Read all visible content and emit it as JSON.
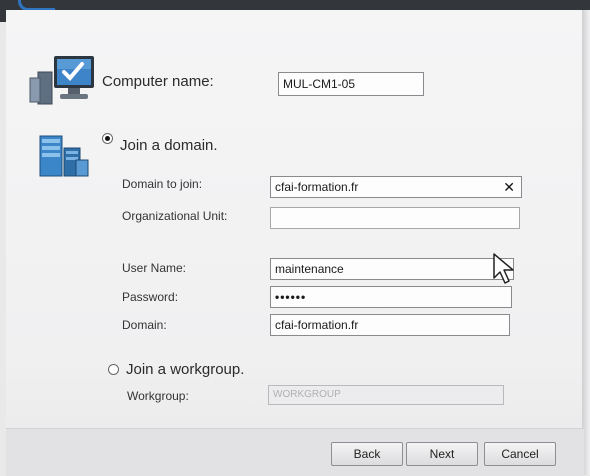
{
  "computer": {
    "label": "Computer name:",
    "value": "MUL-CM1-05"
  },
  "join_domain": {
    "label": "Join a domain.",
    "selected": true,
    "domain_to_join_label": "Domain to join:",
    "domain_to_join_value": "cfai-formation.fr",
    "clear_symbol": "✕",
    "ou_label": "Organizational Unit:",
    "ou_value": "",
    "username_label": "User Name:",
    "username_value": "maintenance",
    "password_label": "Password:",
    "password_value": "••••••",
    "domain_label": "Domain:",
    "domain_value": "cfai-formation.fr"
  },
  "join_workgroup": {
    "label": "Join a workgroup.",
    "selected": false,
    "workgroup_label": "Workgroup:",
    "workgroup_value": "WORKGROUP"
  },
  "buttons": {
    "back": "Back",
    "next": "Next",
    "cancel": "Cancel"
  },
  "icons": [
    "computer-monitor-icon",
    "domain-server-icon",
    "clear-icon",
    "mouse-cursor-icon"
  ],
  "colors": {
    "accent_blue": "#2f74c0",
    "field_border": "#8a8a8e"
  }
}
